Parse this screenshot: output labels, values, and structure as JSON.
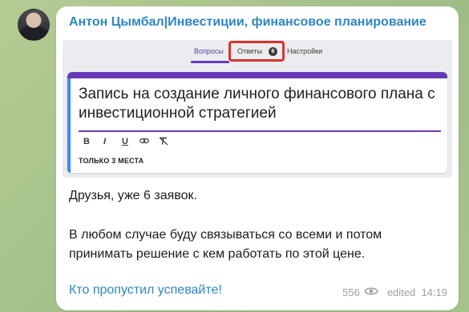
{
  "channel": {
    "sender_name": "Антон Цымбал|Инвестиции, финансовое планирование"
  },
  "embed": {
    "tabs": {
      "questions": "Вопросы",
      "answers": "Ответы",
      "answers_count": "6",
      "settings": "Настройки"
    },
    "form_title": "Запись на создание личного финансового плана с инвестиционной стратегией",
    "toolbar": {
      "bold": "B",
      "italic": "I",
      "underline": "U"
    },
    "subtitle": "ТОЛЬКО 3 МЕСТА"
  },
  "message": {
    "line1": "Друзья, уже 6 заявок.",
    "line2": "В любом случае буду связываться со всеми и потом принимать решение с кем работать по этой цене.",
    "link": "Кто пропустил успевайте!",
    "views": "556",
    "edited_time": "edited  14:19"
  },
  "colors": {
    "accent_purple": "#673ab7",
    "link_blue": "#2e86c1",
    "highlight_red": "#d8322f"
  }
}
